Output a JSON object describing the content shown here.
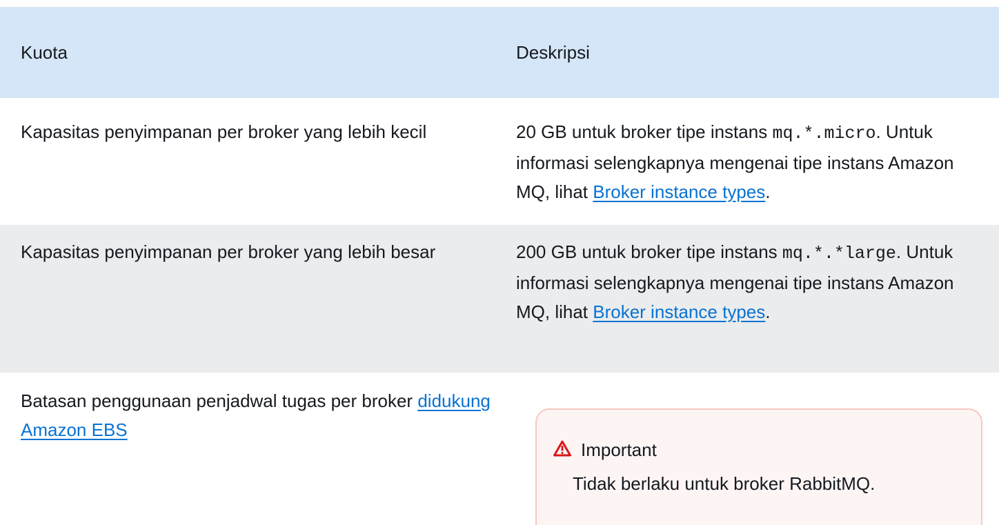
{
  "header": {
    "col1": "Kuota",
    "col2": "Deskripsi"
  },
  "rows": [
    {
      "quota": "Kapasitas penyimpanan per broker yang lebih kecil",
      "desc": {
        "prefix": "20 GB untuk broker tipe instans ",
        "code": "mq.*.micro",
        "middle": ". Untuk informasi selengkapnya mengenai tipe instans Amazon MQ, lihat ",
        "link": "Broker instance types",
        "suffix": "."
      }
    },
    {
      "quota": "Kapasitas penyimpanan per broker yang lebih besar",
      "desc": {
        "prefix": "200 GB untuk broker tipe instans ",
        "code": "mq.*.*large",
        "middle": ". Untuk informasi selengkapnya mengenai tipe instans Amazon MQ, lihat ",
        "link": "Broker instance types",
        "suffix": "."
      }
    },
    {
      "quota_prefix": "Batasan penggunaan penjadwal tugas per broker ",
      "quota_link": "didukung Amazon EBS",
      "important": {
        "title": "Important",
        "body": "Tidak berlaku untuk broker RabbitMQ."
      }
    }
  ],
  "colors": {
    "header_bg": "#d4e6f7",
    "alt_row_bg": "#eaeced",
    "link": "#0972d3",
    "warning": "#d91515"
  },
  "icons": {
    "important": "warning-triangle-icon"
  }
}
